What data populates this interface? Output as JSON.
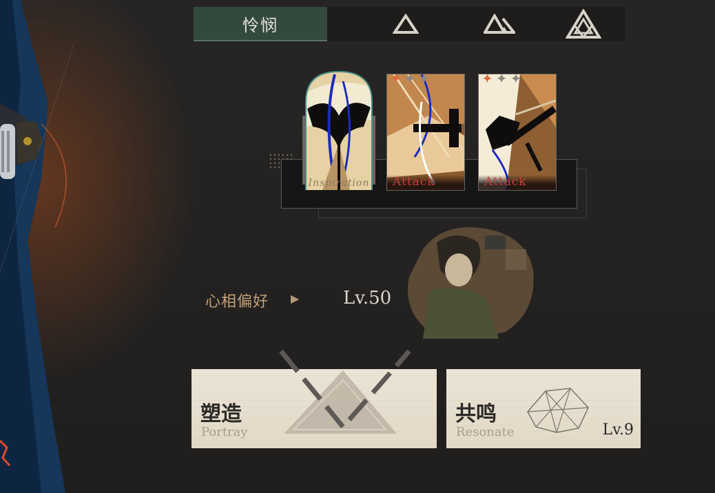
{
  "tabs": [
    {
      "label": "怜悯",
      "active": true
    },
    {
      "icon": "triangle-icon",
      "active": false
    },
    {
      "icon": "double-triangle-icon",
      "active": false
    },
    {
      "icon": "triple-triangle-icon",
      "active": false
    }
  ],
  "cards": [
    {
      "label": "Inspiration",
      "type": "ultimate"
    },
    {
      "label": "Attack",
      "stars": 1,
      "max_stars": 3
    },
    {
      "label": "Attack",
      "stars": 1,
      "max_stars": 3
    }
  ],
  "preference": {
    "label": "心相偏好",
    "level": "Lv.50"
  },
  "actions": {
    "portray": {
      "title": "塑造",
      "subtitle": "Portray"
    },
    "resonate": {
      "title": "共鸣",
      "subtitle": "Resonate",
      "level": "Lv.9"
    }
  },
  "colors": {
    "tab_active": "#34493e",
    "preference_text": "#c2a078",
    "card_label_red": "#c3403d",
    "star_active": "#e36a3a",
    "star_inactive": "#8c8884",
    "button_bg": "#e6dece"
  }
}
